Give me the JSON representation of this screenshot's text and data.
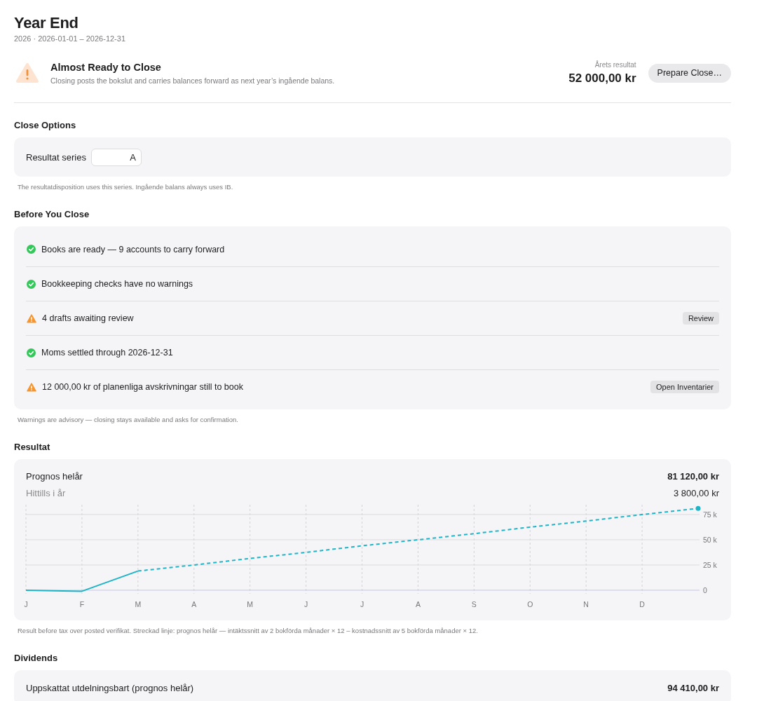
{
  "page": {
    "title": "Year End",
    "subtitle": "2026 · 2026-01-01 – 2026-12-31"
  },
  "status_banner": {
    "kind": "warning",
    "title": "Almost Ready to Close",
    "description": "Closing posts the bokslut and carries balances forward as next year’s ingående balans.",
    "result_label": "Årets resultat",
    "result_value": "52 000,00 kr",
    "button": "Prepare Close…"
  },
  "close_options": {
    "heading": "Close Options",
    "field_label": "Resultat series",
    "field_value": "A",
    "note": "The resultatdisposition uses this series. Ingående balans always uses IB."
  },
  "checklist": {
    "heading": "Before You Close",
    "items": [
      {
        "kind": "ok",
        "text": "Books are ready — 9 accounts to carry forward"
      },
      {
        "kind": "ok",
        "text": "Bookkeeping checks have no warnings"
      },
      {
        "kind": "warning",
        "text": "4 drafts awaiting review",
        "action": "Review"
      },
      {
        "kind": "ok",
        "text": "Moms settled through 2026-12-31"
      },
      {
        "kind": "warning",
        "text": "12 000,00 kr of planenliga avskrivningar still to book",
        "action": "Open Inventarier"
      }
    ],
    "note": "Warnings are advisory — closing stays available and asks for confirmation."
  },
  "resultat": {
    "heading": "Resultat",
    "rows": [
      {
        "kind": "total",
        "label": "Prognos helår",
        "value": "81 120,00 kr"
      },
      {
        "kind": "sub",
        "label": "Hittills i år",
        "value": "3 800,00 kr"
      }
    ],
    "chart_data": {
      "type": "line",
      "grid": true,
      "categories": [
        "J",
        "F",
        "M",
        "A",
        "M",
        "J",
        "J",
        "A",
        "S",
        "O",
        "N",
        "D",
        null
      ],
      "ylim": [
        -3500,
        84700
      ],
      "yticks": [
        {
          "value": 0,
          "label": "0"
        },
        {
          "value": 25000,
          "label": "25 k"
        },
        {
          "value": 50000,
          "label": "50 k"
        },
        {
          "value": 75000,
          "label": "75 k"
        }
      ],
      "series": [
        {
          "color": "#1db4c8",
          "line_style": "solid",
          "values": [
            0,
            -1000,
            19000,
            null,
            null,
            null,
            null,
            null,
            null,
            null,
            null,
            null,
            null
          ]
        },
        {
          "color": "#1db4c8",
          "line_style": "dashed",
          "values": [
            null,
            null,
            19000,
            25000,
            31500,
            37500,
            44000,
            50000,
            56000,
            62500,
            68500,
            75000,
            81000
          ]
        }
      ]
    },
    "note": "Result before tax over posted verifikat. Streckad linje: prognos helår — intäktssnitt av 2 bokförda månader × 12 – kostnadssnitt av 5 bokförda månader × 12."
  },
  "dividends": {
    "heading": "Dividends",
    "rows": [
      {
        "kind": "total",
        "label": "Uppskattat utdelningsbart (prognos helår)",
        "value": "94 410,00 kr"
      }
    ]
  }
}
